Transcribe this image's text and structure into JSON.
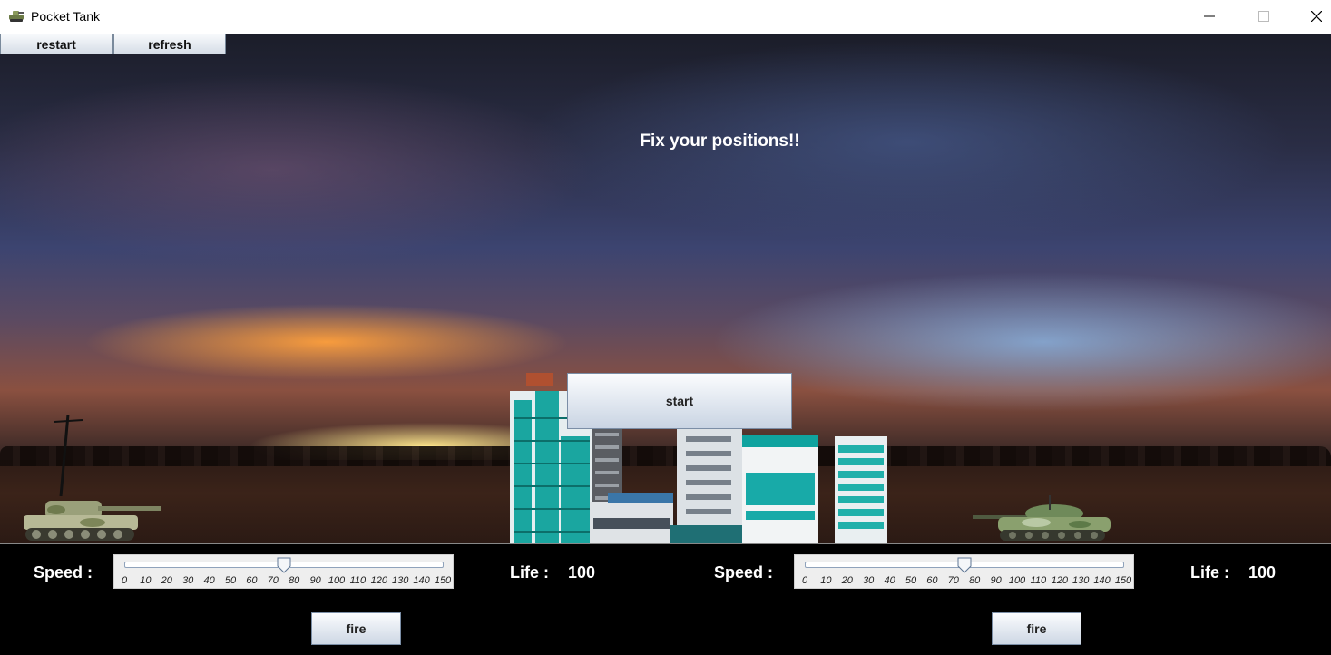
{
  "window": {
    "title": "Pocket Tank"
  },
  "toolbar": {
    "restart_label": "restart",
    "refresh_label": "refresh"
  },
  "scene": {
    "message": "Fix your positions!!",
    "start_label": "start"
  },
  "players": [
    {
      "speed_label": "Speed :",
      "life_label": "Life :",
      "life_value": "100",
      "speed_value": 75,
      "fire_label": "fire"
    },
    {
      "speed_label": "Speed :",
      "life_label": "Life :",
      "life_value": "100",
      "speed_value": 75,
      "fire_label": "fire"
    }
  ],
  "slider_ticks": [
    "0",
    "10",
    "20",
    "30",
    "40",
    "50",
    "60",
    "70",
    "80",
    "90",
    "100",
    "110",
    "120",
    "130",
    "140",
    "150"
  ],
  "slider_range": [
    0,
    150
  ]
}
